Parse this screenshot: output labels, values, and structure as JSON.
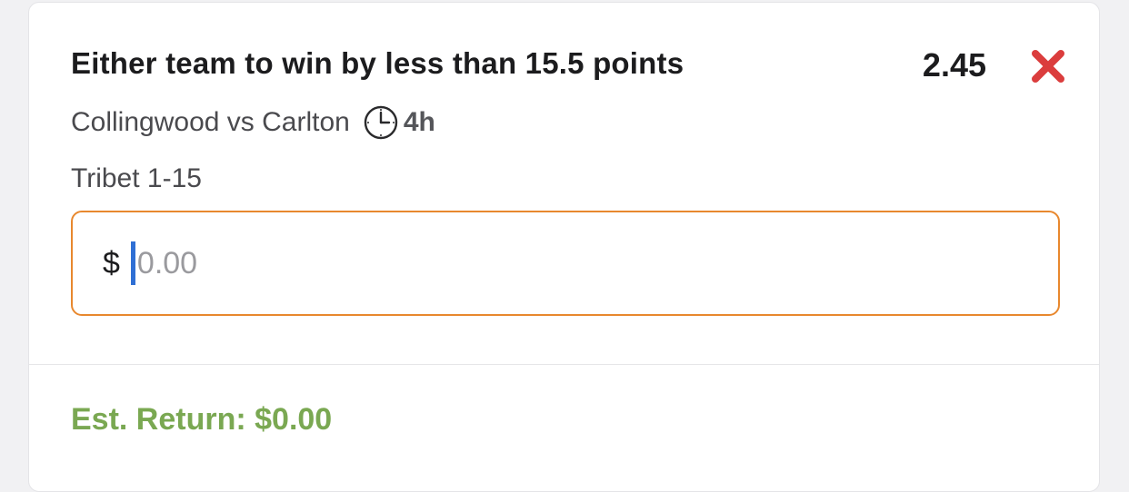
{
  "bet": {
    "selection": "Either team to win by less than 15.5 points",
    "odds": "2.45",
    "match": "Collingwood vs Carlton",
    "time_to_start": "4h",
    "market": "Tribet 1-15"
  },
  "stake": {
    "currency_symbol": "$",
    "value": "",
    "placeholder": "0.00"
  },
  "footer": {
    "est_return": "Est. Return: $0.00"
  },
  "icons": {
    "remove": "close-x-icon",
    "clock": "clock-icon"
  },
  "colors": {
    "remove_icon": "#db3d3d",
    "input_border": "#e8882e",
    "cursor": "#2f6fd4",
    "est_return": "#7aa852"
  }
}
